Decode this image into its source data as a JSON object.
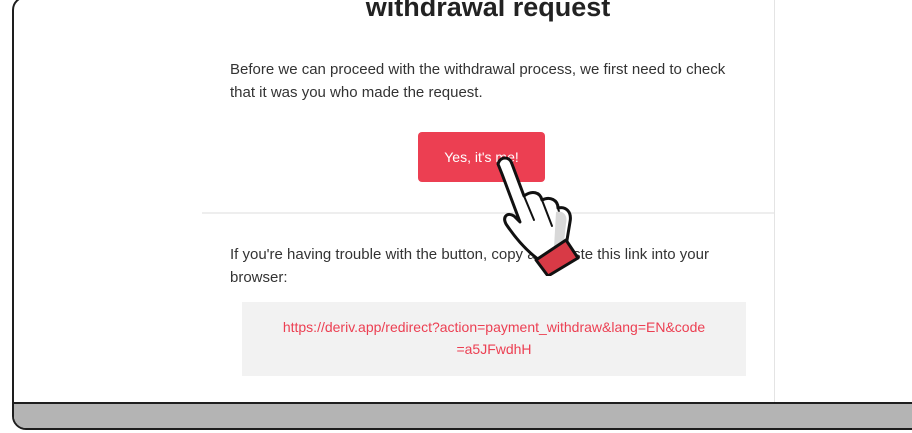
{
  "email": {
    "title": "withdrawal request",
    "intro": "Before we can proceed with the withdrawal process, we first need to check that it was you who made the request.",
    "confirm_button": "Yes, it's me!",
    "trouble_text": "If you're having trouble with the button, copy and paste this link into your browser:",
    "link": "https://deriv.app/redirect?action=payment_withdraw&lang=EN&code=a5JFwdhH"
  },
  "colors": {
    "accent": "#ec3f52",
    "bottom_bar": "#b4b4b4"
  },
  "icons": {
    "pointer": "hand-pointer-icon"
  }
}
